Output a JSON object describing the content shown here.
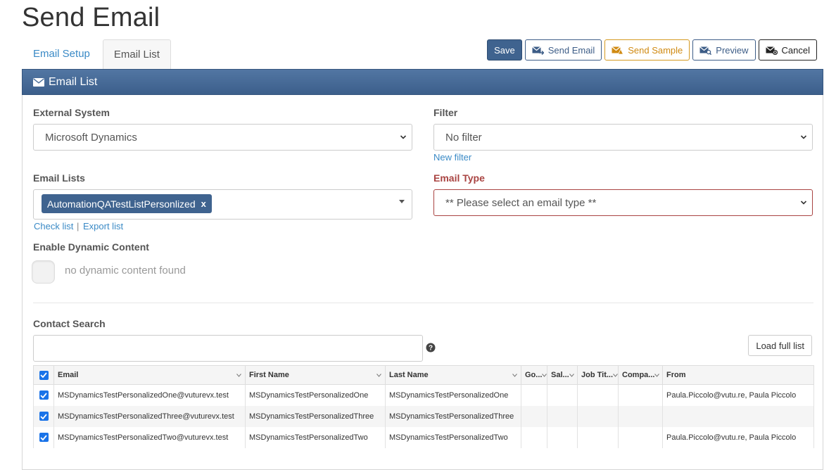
{
  "page": {
    "title": "Send Email"
  },
  "tabs": [
    {
      "label": "Email Setup",
      "active": false
    },
    {
      "label": "Email List",
      "active": true
    }
  ],
  "toolbar": {
    "save": "Save",
    "send_email": "Send Email",
    "send_sample": "Send Sample",
    "preview": "Preview",
    "cancel": "Cancel"
  },
  "panel": {
    "title": "Email List",
    "icon": "envelope-icon"
  },
  "external_system": {
    "label": "External System",
    "value": "Microsoft Dynamics"
  },
  "filter": {
    "label": "Filter",
    "value": "No filter",
    "new_link": "New filter"
  },
  "email_lists": {
    "label": "Email Lists",
    "selected": [
      "AutomationQATestListPersonlized"
    ],
    "chip_remove": "x",
    "check_link": "Check list",
    "separator": "|",
    "export_link": "Export list"
  },
  "email_type": {
    "label": "Email Type",
    "placeholder": "** Please select an email type **"
  },
  "dynamic_content": {
    "label": "Enable Dynamic Content",
    "status": "no dynamic content found"
  },
  "contact_search": {
    "label": "Contact Search",
    "value": "",
    "load_button": "Load full list"
  },
  "grid": {
    "columns": [
      "Email",
      "First Name",
      "Last Name",
      "Go...",
      "Sal...",
      "Job Tit...",
      "Compa...",
      "From"
    ],
    "rows": [
      {
        "checked": true,
        "cells": [
          "MSDynamicsTestPersonalizedOne@vuturevx.test",
          "MSDynamicsTestPersonalizedOne",
          "MSDynamicsTestPersonalizedOne",
          "",
          "",
          "",
          "",
          "Paula.Piccolo@vutu.re, Paula Piccolo"
        ]
      },
      {
        "checked": true,
        "cells": [
          "MSDynamicsTestPersonalizedThree@vuturevx.test",
          "MSDynamicsTestPersonalizedThree",
          "MSDynamicsTestPersonalizedThree",
          "",
          "",
          "",
          "",
          ""
        ]
      },
      {
        "checked": true,
        "cells": [
          "MSDynamicsTestPersonalizedTwo@vuturevx.test",
          "MSDynamicsTestPersonalizedTwo",
          "MSDynamicsTestPersonalizedTwo",
          "",
          "",
          "",
          "",
          "Paula.Piccolo@vutu.re, Paula Piccolo"
        ]
      }
    ]
  },
  "colors": {
    "primary": "#3f638f",
    "link": "#3a8ac6",
    "warning": "#d08a12",
    "error": "#a94442",
    "checkbox": "#1a73e8"
  }
}
